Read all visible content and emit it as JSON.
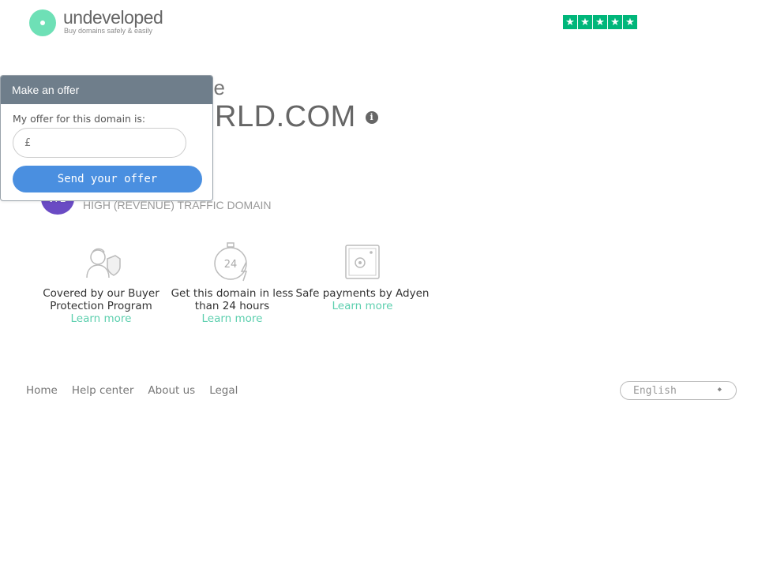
{
  "header": {
    "logo_text": "undeveloped",
    "logo_tagline": "Buy domains safely & easily",
    "trust_stars": [
      "★",
      "★",
      "★",
      "★",
      "★"
    ]
  },
  "hero": {
    "headline_fragment": "he",
    "domain_fragment": "ORLD.COM",
    "info_icon_glyph": "i"
  },
  "traffic": {
    "badge_text": "I↑E",
    "label": "HIGH (REVENUE) TRAFFIC DOMAIN"
  },
  "features": [
    {
      "icon": "shield-person-icon",
      "text": "Covered by our Buyer Protection Program",
      "link": "Learn more"
    },
    {
      "icon": "stopwatch-24-icon",
      "text": "Get this domain in less than 24 hours",
      "link": "Learn more"
    },
    {
      "icon": "safe-icon",
      "text": "Safe payments by Adyen",
      "link": "Learn more"
    }
  ],
  "footer": {
    "nav": [
      "Home",
      "Help center",
      "About us",
      "Legal"
    ],
    "language": "English",
    "language_arrow": "◆"
  },
  "offer_panel": {
    "title": "Make an offer",
    "label": "My offer for this domain is:",
    "currency": "£",
    "input_value": "",
    "button_label": "Send your offer"
  },
  "colors": {
    "brand_green": "#6ee0b6",
    "trust_green": "#00b67a",
    "link_green": "#5ccfae",
    "offer_header": "#6f7e8b",
    "offer_button": "#4a8fe0",
    "traffic_badge": "#6a4bc4"
  }
}
